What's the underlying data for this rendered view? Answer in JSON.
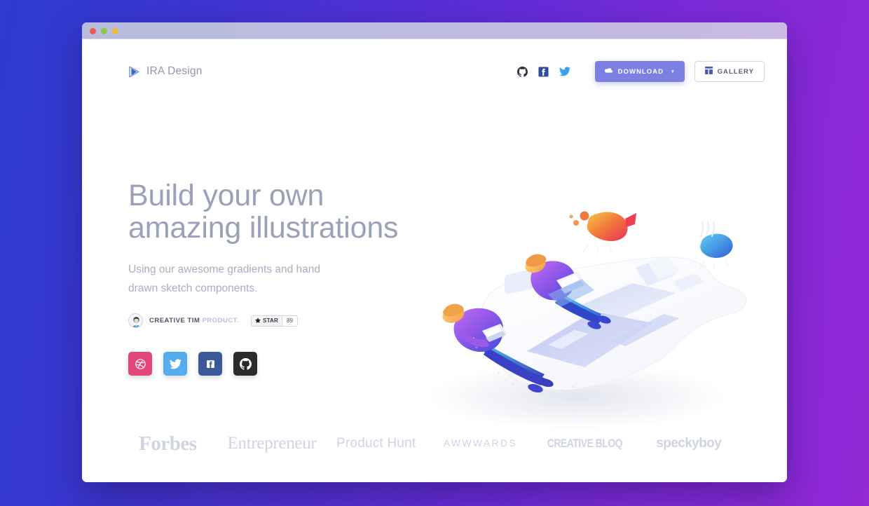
{
  "window": {
    "traffic_lights": [
      "close",
      "minimize",
      "maximize"
    ]
  },
  "header": {
    "brand_name": "IRA Design",
    "brand_icon": "play-triangle-logo-icon",
    "social_icons": [
      "github-icon",
      "facebook-icon",
      "twitter-icon"
    ],
    "download_label": "DOWNLOAD",
    "download_icon": "cloud-download-icon",
    "download_caret": "▾",
    "gallery_label": "GALLERY",
    "gallery_icon": "grid-gallery-icon"
  },
  "hero": {
    "headline_line1": "Build your own",
    "headline_line2": "amazing illustrations",
    "subheadline_line1": "Using our awesome gradients and hand",
    "subheadline_line2": "drawn sketch components.",
    "avatar_icon": "creative-tim-avatar-icon",
    "product_label": "CREATIVE TIM ",
    "product_suffix": "PRODUCT.",
    "star_label": "STAR",
    "star_icon": "star-icon",
    "star_count": "89",
    "social_buttons": [
      {
        "name": "dribbble",
        "icon": "dribbble-icon",
        "color": "#e0457b"
      },
      {
        "name": "twitter",
        "icon": "twitter-icon",
        "color": "#55acee"
      },
      {
        "name": "facebook",
        "icon": "facebook-icon",
        "color": "#3b5998"
      },
      {
        "name": "github",
        "icon": "github-icon",
        "color": "#2b2b2b"
      }
    ],
    "illustration_alt": "isometric-illustration-two-people-with-laptops"
  },
  "brand_logos": [
    {
      "name": "forbes",
      "text": "Forbes"
    },
    {
      "name": "entrepreneur",
      "text": "Entrepreneur"
    },
    {
      "name": "product-hunt",
      "text": "Product Hunt"
    },
    {
      "name": "awwwards",
      "text": "AWWWARDS"
    },
    {
      "name": "creative-bloq",
      "text": "CREATIVE BLOQ"
    },
    {
      "name": "speckyboy",
      "text": "speckyboy"
    }
  ],
  "colors": {
    "backdrop_start": "#2c3bd0",
    "backdrop_end": "#9228d6",
    "accent_button": "#7b80e2",
    "headline": "#9aa1b9",
    "body_text": "#a8aec2",
    "brand_logo": "#ccd1e0"
  }
}
